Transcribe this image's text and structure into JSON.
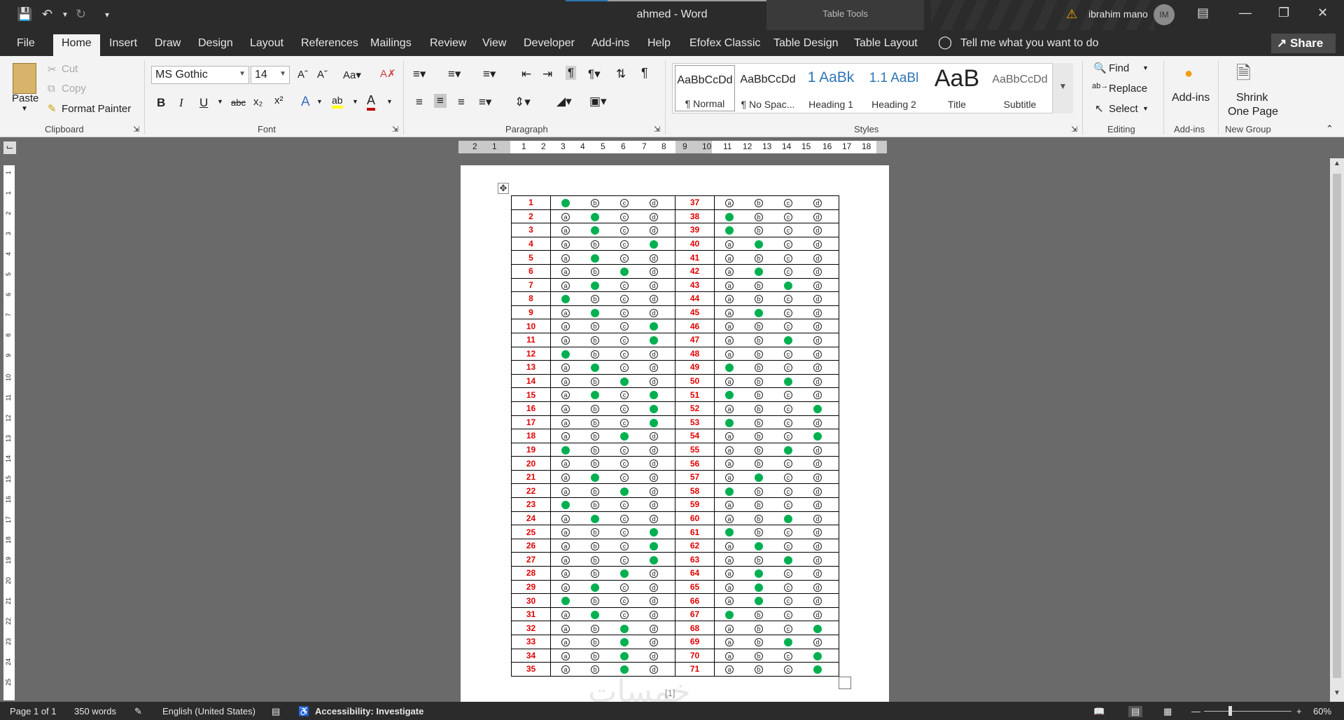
{
  "titlebar": {
    "title": "ahmed  -  Word",
    "context_tab_group": "Table Tools",
    "user_name": "ibrahim mano",
    "user_initials": "IM"
  },
  "menu": {
    "tabs": [
      "File",
      "Home",
      "Insert",
      "Draw",
      "Design",
      "Layout",
      "References",
      "Mailings",
      "Review",
      "View",
      "Developer",
      "Add-ins",
      "Help",
      "Efofex Classic",
      "Table Design",
      "Table Layout"
    ],
    "active": "Home",
    "tell_me": "Tell me what you want to do",
    "share": "Share"
  },
  "ribbon": {
    "clipboard": {
      "paste": "Paste",
      "cut": "Cut",
      "copy": "Copy",
      "format_painter": "Format Painter",
      "label": "Clipboard"
    },
    "font": {
      "name": "MS Gothic",
      "size": "14",
      "label": "Font"
    },
    "paragraph": {
      "label": "Paragraph"
    },
    "styles": {
      "label": "Styles",
      "items": [
        {
          "preview": "AaBbCcDd",
          "name": "¶ Normal"
        },
        {
          "preview": "AaBbCcDd",
          "name": "¶ No Spac..."
        },
        {
          "preview": "1  AaBk",
          "name": "Heading 1"
        },
        {
          "preview": "1.1  AaBl",
          "name": "Heading 2"
        },
        {
          "preview": "AaB",
          "name": "Title"
        },
        {
          "preview": "AaBbCcDd",
          "name": "Subtitle"
        }
      ]
    },
    "editing": {
      "find": "Find",
      "replace": "Replace",
      "select": "Select",
      "label": "Editing"
    },
    "addins": {
      "button": "Add-ins",
      "label": "Add-ins"
    },
    "newgroup": {
      "button_line1": "Shrink",
      "button_line2": "One Page",
      "label": "New Group"
    }
  },
  "ruler": {
    "h_ticks": [
      "2",
      "1",
      "1",
      "2",
      "3",
      "4",
      "5",
      "6",
      "7",
      "8",
      "9",
      "10",
      "11",
      "12",
      "13",
      "14",
      "15",
      "16",
      "17",
      "18"
    ],
    "v_ticks": [
      "1",
      "1",
      "2",
      "3",
      "4",
      "5",
      "6",
      "7",
      "8",
      "9",
      "10",
      "11",
      "12",
      "13",
      "14",
      "15",
      "16",
      "17",
      "18",
      "19",
      "20",
      "21",
      "22",
      "23",
      "24",
      "25"
    ]
  },
  "document": {
    "page_number": "[1]",
    "watermark": "خمسات",
    "answer_sheet": [
      {
        "left": {
          "num": "1",
          "ans": "a"
        },
        "right": {
          "num": "37",
          "ans": "none"
        }
      },
      {
        "left": {
          "num": "2",
          "ans": "b"
        },
        "right": {
          "num": "38",
          "ans": "a"
        }
      },
      {
        "left": {
          "num": "3",
          "ans": "b"
        },
        "right": {
          "num": "39",
          "ans": "a"
        }
      },
      {
        "left": {
          "num": "4",
          "ans": "d"
        },
        "right": {
          "num": "40",
          "ans": "b"
        }
      },
      {
        "left": {
          "num": "5",
          "ans": "b"
        },
        "right": {
          "num": "41",
          "ans": "none"
        }
      },
      {
        "left": {
          "num": "6",
          "ans": "c"
        },
        "right": {
          "num": "42",
          "ans": "b"
        }
      },
      {
        "left": {
          "num": "7",
          "ans": "b"
        },
        "right": {
          "num": "43",
          "ans": "c"
        }
      },
      {
        "left": {
          "num": "8",
          "ans": "a"
        },
        "right": {
          "num": "44",
          "ans": "none"
        }
      },
      {
        "left": {
          "num": "9",
          "ans": "b"
        },
        "right": {
          "num": "45",
          "ans": "b"
        }
      },
      {
        "left": {
          "num": "10",
          "ans": "d"
        },
        "right": {
          "num": "46",
          "ans": "none"
        }
      },
      {
        "left": {
          "num": "11",
          "ans": "d"
        },
        "right": {
          "num": "47",
          "ans": "c"
        }
      },
      {
        "left": {
          "num": "12",
          "ans": "a"
        },
        "right": {
          "num": "48",
          "ans": "none"
        }
      },
      {
        "left": {
          "num": "13",
          "ans": "b"
        },
        "right": {
          "num": "49",
          "ans": "a"
        }
      },
      {
        "left": {
          "num": "14",
          "ans": "c"
        },
        "right": {
          "num": "50",
          "ans": "c"
        }
      },
      {
        "left": {
          "num": "15",
          "ans": "bd"
        },
        "right": {
          "num": "51",
          "ans": "a"
        }
      },
      {
        "left": {
          "num": "16",
          "ans": "d"
        },
        "right": {
          "num": "52",
          "ans": "d"
        }
      },
      {
        "left": {
          "num": "17",
          "ans": "d"
        },
        "right": {
          "num": "53",
          "ans": "a"
        }
      },
      {
        "left": {
          "num": "18",
          "ans": "c"
        },
        "right": {
          "num": "54",
          "ans": "d"
        }
      },
      {
        "left": {
          "num": "19",
          "ans": "a"
        },
        "right": {
          "num": "55",
          "ans": "c"
        }
      },
      {
        "left": {
          "num": "20",
          "ans": "none"
        },
        "right": {
          "num": "56",
          "ans": "none"
        }
      },
      {
        "left": {
          "num": "21",
          "ans": "b"
        },
        "right": {
          "num": "57",
          "ans": "b"
        }
      },
      {
        "left": {
          "num": "22",
          "ans": "c"
        },
        "right": {
          "num": "58",
          "ans": "a"
        }
      },
      {
        "left": {
          "num": "23",
          "ans": "a"
        },
        "right": {
          "num": "59",
          "ans": "none"
        }
      },
      {
        "left": {
          "num": "24",
          "ans": "b"
        },
        "right": {
          "num": "60",
          "ans": "c"
        }
      },
      {
        "left": {
          "num": "25",
          "ans": "d"
        },
        "right": {
          "num": "61",
          "ans": "a"
        }
      },
      {
        "left": {
          "num": "26",
          "ans": "d"
        },
        "right": {
          "num": "62",
          "ans": "b"
        }
      },
      {
        "left": {
          "num": "27",
          "ans": "d"
        },
        "right": {
          "num": "63",
          "ans": "c"
        }
      },
      {
        "left": {
          "num": "28",
          "ans": "c"
        },
        "right": {
          "num": "64",
          "ans": "b"
        }
      },
      {
        "left": {
          "num": "29",
          "ans": "b"
        },
        "right": {
          "num": "65",
          "ans": "b"
        }
      },
      {
        "left": {
          "num": "30",
          "ans": "a"
        },
        "right": {
          "num": "66",
          "ans": "b"
        }
      },
      {
        "left": {
          "num": "31",
          "ans": "b"
        },
        "right": {
          "num": "67",
          "ans": "a"
        }
      },
      {
        "left": {
          "num": "32",
          "ans": "c"
        },
        "right": {
          "num": "68",
          "ans": "d"
        }
      },
      {
        "left": {
          "num": "33",
          "ans": "c"
        },
        "right": {
          "num": "69",
          "ans": "c"
        }
      },
      {
        "left": {
          "num": "34",
          "ans": "c"
        },
        "right": {
          "num": "70",
          "ans": "d"
        }
      },
      {
        "left": {
          "num": "35",
          "ans": "c"
        },
        "right": {
          "num": "71",
          "ans": "d"
        }
      }
    ]
  },
  "statusbar": {
    "page": "Page 1 of 1",
    "words": "350 words",
    "language": "English (United States)",
    "accessibility": "Accessibility: Investigate",
    "zoom": "60%"
  },
  "colors": {
    "accent": "#00b050",
    "number_red": "#e00000",
    "chrome": "#2b2b2b",
    "ribbon": "#f3f3f3"
  }
}
